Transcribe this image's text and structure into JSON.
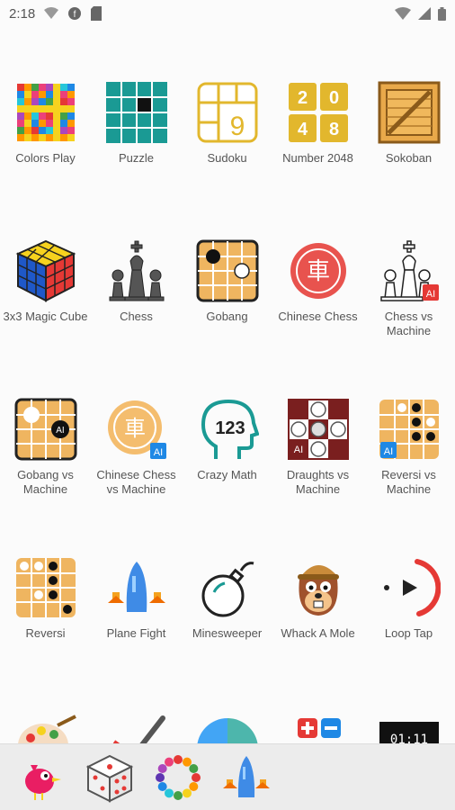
{
  "status_bar": {
    "time": "2:18",
    "left_icons": [
      "wifi-icon",
      "browser-icon",
      "sim-card-icon"
    ],
    "right_icons": [
      "wifi-signal-icon",
      "cell-signal-icon",
      "battery-icon"
    ]
  },
  "games": [
    {
      "label": "Colors Play",
      "icon": "colors-grid-icon"
    },
    {
      "label": "Puzzle",
      "icon": "puzzle-grid-icon"
    },
    {
      "label": "Sudoku",
      "icon": "sudoku-icon",
      "icon_text": "9"
    },
    {
      "label": "Number 2048",
      "icon": "number-2048-icon",
      "icon_text": [
        "2",
        "0",
        "4",
        "8"
      ]
    },
    {
      "label": "Sokoban",
      "icon": "crate-icon"
    },
    {
      "label": "3x3 Magic Cube",
      "icon": "rubiks-cube-icon"
    },
    {
      "label": "Chess",
      "icon": "chess-pieces-icon"
    },
    {
      "label": "Gobang",
      "icon": "gobang-board-icon"
    },
    {
      "label": "Chinese Chess",
      "icon": "chinese-chess-piece-icon",
      "icon_text": "車"
    },
    {
      "label": "Chess vs Machine",
      "icon": "chess-ai-icon",
      "icon_text": "AI"
    },
    {
      "label": "Gobang vs Machine",
      "icon": "gobang-ai-icon",
      "icon_text": "AI"
    },
    {
      "label": "Chinese Chess vs Machine",
      "icon": "chinese-chess-ai-icon",
      "icon_text": [
        "車",
        "AI"
      ]
    },
    {
      "label": "Crazy Math",
      "icon": "head-123-icon",
      "icon_text": "123"
    },
    {
      "label": "Draughts vs Machine",
      "icon": "draughts-ai-icon",
      "icon_text": "AI"
    },
    {
      "label": "Reversi vs Machine",
      "icon": "reversi-ai-icon",
      "icon_text": "AI"
    },
    {
      "label": "Reversi",
      "icon": "reversi-board-icon"
    },
    {
      "label": "Plane Fight",
      "icon": "rocket-plane-icon"
    },
    {
      "label": "Minesweeper",
      "icon": "bomb-icon"
    },
    {
      "label": "Whack A Mole",
      "icon": "mole-icon"
    },
    {
      "label": "Loop Tap",
      "icon": "loop-tap-icon"
    },
    {
      "label": "",
      "icon": "paint-palette-icon"
    },
    {
      "label": "",
      "icon": "pencil-draw-icon"
    },
    {
      "label": "",
      "icon": "color-wheel-icon"
    },
    {
      "label": "",
      "icon": "plus-minus-icon"
    },
    {
      "label": "",
      "icon": "digital-timer-icon",
      "icon_text": "01:11"
    }
  ],
  "bottom_bar": [
    {
      "icon": "pink-bird-icon"
    },
    {
      "icon": "dice-icon"
    },
    {
      "icon": "rainbow-ring-icon"
    },
    {
      "icon": "rocket-plane-icon"
    }
  ],
  "colors": {
    "background": "#fbfbfb",
    "bottom_bar": "#ececec",
    "label": "#555555",
    "teal": "#1a9a94",
    "gold": "#e2b72d",
    "wood": "#e9b158",
    "red": "#e53935",
    "blue": "#1e88e5"
  }
}
